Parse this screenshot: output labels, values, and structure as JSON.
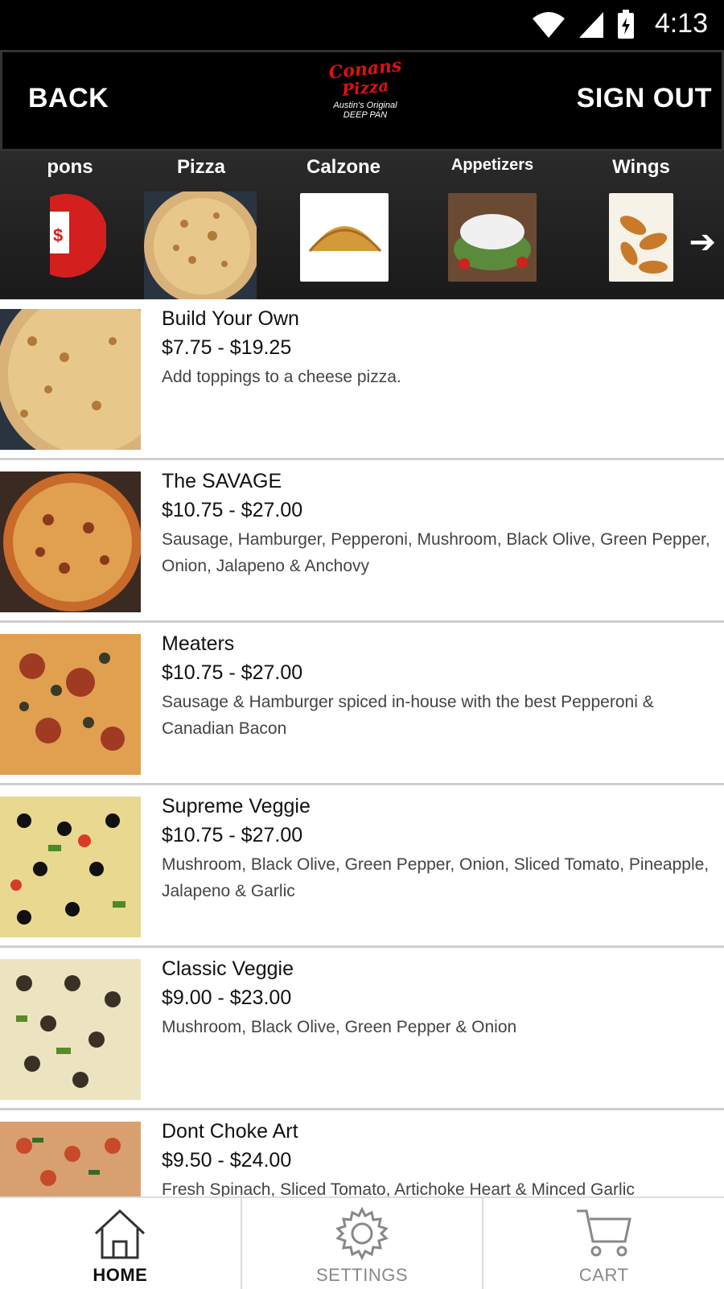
{
  "status": {
    "time": "4:13"
  },
  "header": {
    "back_label": "BACK",
    "signout_label": "SIGN OUT",
    "logo_line1": "Conans",
    "logo_line2": "Pizza",
    "logo_line3": "Austin's Original",
    "logo_line4": "DEEP PAN"
  },
  "categories": [
    {
      "label": "pons"
    },
    {
      "label": "Pizza"
    },
    {
      "label": "Calzone"
    },
    {
      "label": "Appetizers"
    },
    {
      "label": "Wings"
    }
  ],
  "menu_items": [
    {
      "name": "Build Your Own",
      "price": "$7.75 - $19.25",
      "desc": "Add toppings to a cheese pizza."
    },
    {
      "name": "The SAVAGE",
      "price": "$10.75 - $27.00",
      "desc": "Sausage, Hamburger, Pepperoni, Mushroom, Black Olive, Green Pepper, Onion, Jalapeno & Anchovy"
    },
    {
      "name": "Meaters",
      "price": "$10.75 - $27.00",
      "desc": "Sausage & Hamburger spiced in-house with the best Pepperoni & Canadian Bacon"
    },
    {
      "name": "Supreme Veggie",
      "price": "$10.75 - $27.00",
      "desc": "Mushroom, Black Olive, Green Pepper, Onion, Sliced Tomato, Pineapple, Jalapeno & Garlic"
    },
    {
      "name": "Classic Veggie",
      "price": "$9.00 - $23.00",
      "desc": "Mushroom, Black Olive, Green Pepper & Onion"
    },
    {
      "name": "Dont Choke Art",
      "price": "$9.50 - $24.00",
      "desc": "Fresh Spinach, Sliced Tomato, Artichoke Heart & Minced Garlic"
    }
  ],
  "tabs": [
    {
      "label": "HOME",
      "icon": "home-icon",
      "active": true
    },
    {
      "label": "SETTINGS",
      "icon": "gear-icon",
      "active": false
    },
    {
      "label": "CART",
      "icon": "cart-icon",
      "active": false
    }
  ],
  "colors": {
    "brand_red": "#dd1111",
    "header_bg": "#000000",
    "active_tab": "#111111",
    "inactive_tab": "#888888"
  }
}
